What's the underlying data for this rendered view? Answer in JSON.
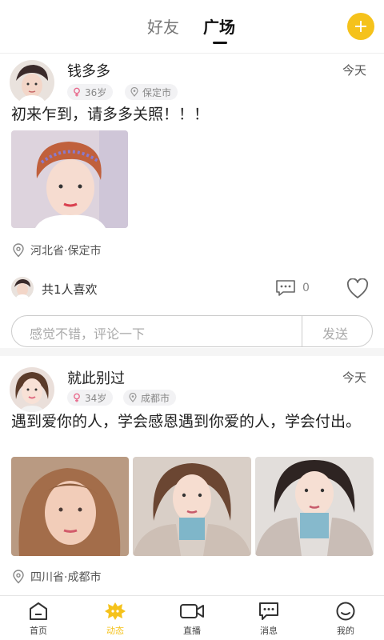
{
  "header": {
    "tab_friends": "好友",
    "tab_square": "广场",
    "add_icon": "plus-circle-icon",
    "accent": "#f5c21b"
  },
  "posts": [
    {
      "username": "钱多多",
      "date": "今天",
      "age": "36岁",
      "city": "保定市",
      "text": "初来乍到，请多多关照！！！",
      "location": "河北省·保定市",
      "likes": "共1人喜欢",
      "comments": "0",
      "comment_placeholder": "感觉不错，评论一下",
      "send_label": "发送"
    },
    {
      "username": "就此别过",
      "date": "今天",
      "age": "34岁",
      "city": "成都市",
      "text": "遇到爱你的人，学会感恩遇到你爱的人，学会付出。",
      "location": "四川省·成都市"
    }
  ],
  "nav": {
    "home": "首页",
    "moments": "动态",
    "live": "直播",
    "messages": "消息",
    "mine": "我的"
  }
}
